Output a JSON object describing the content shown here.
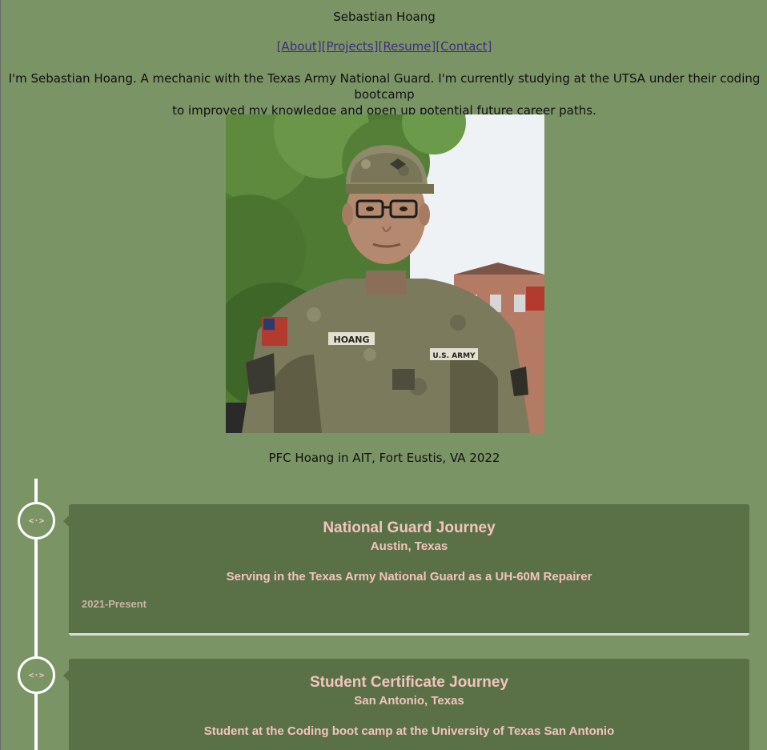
{
  "header": {
    "site_name": "Sebastian Hoang",
    "nav": [
      {
        "label": "[About]"
      },
      {
        "label": "[Projects]"
      },
      {
        "label": "[Resume]"
      },
      {
        "label": "[Contact]"
      }
    ]
  },
  "about": {
    "intro_line1": "I'm Sebastian Hoang. A mechanic with the Texas Army National Guard. I'm currently studying at the UTSA under their coding bootcamp",
    "intro_line2": "to improved my knowledge and open up potential future career paths.",
    "photo_caption": "PFC Hoang in AIT, Fort Eustis, VA 2022",
    "photo_icon": "portrait-photo"
  },
  "timeline": {
    "marker_icon": "code-arrows-icon",
    "marker_glyph": "<·>",
    "entries": [
      {
        "title": "National Guard Journey",
        "location": "Austin, Texas",
        "description": "Serving in the Texas Army National Guard as a UH-60M Repairer",
        "date": "2021-Present"
      },
      {
        "title": "Student Certificate Journey",
        "location": "San Antonio, Texas",
        "description": "Student at the Coding boot camp at the University of Texas San Antonio",
        "date": ""
      }
    ]
  },
  "colors": {
    "background": "#7a9466",
    "card": "#5a7148",
    "accent_text": "#f2c4bd",
    "link": "#3c2f80"
  }
}
